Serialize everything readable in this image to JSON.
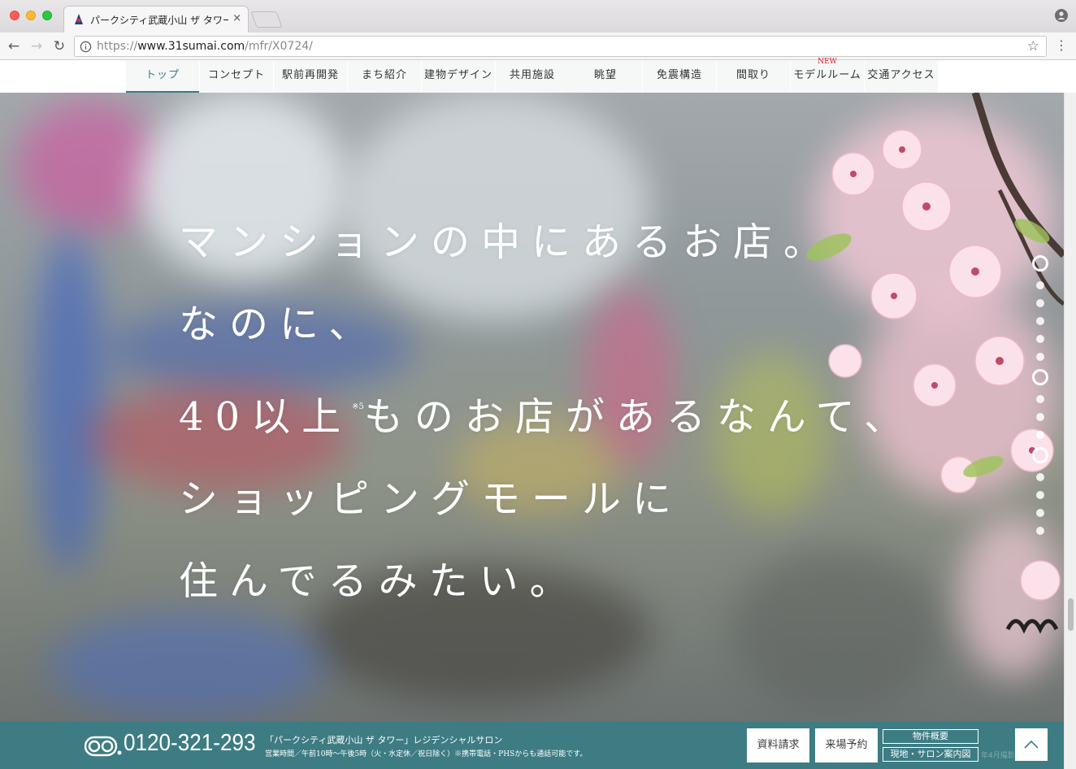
{
  "browser": {
    "tab_title": "パークシティ武蔵小山 ザ タワー",
    "tab_close": "×",
    "url_scheme": "https://",
    "url_host": "www.31sumai.com",
    "url_path": "/mfr/X0724/"
  },
  "nav": {
    "items": [
      "トップ",
      "コンセプト",
      "駅前再開発",
      "まち紹介",
      "建物デザイン",
      "共用施設",
      "眺望",
      "免震構造",
      "間取り",
      "モデルルーム",
      "交通アクセス"
    ],
    "new_badge": "NEW",
    "active_index": 0
  },
  "hero": {
    "lines": [
      "マンションの中にあるお店。",
      "なのに、",
      "40以上",
      "ものお店があるなんて、",
      "ショッピングモールに",
      "住んでるみたい。"
    ],
    "note": "※5",
    "dot_count": 15
  },
  "footer": {
    "phone": "0120-321-293",
    "salon": "「パークシティ武蔵小山 ザ タワー」レジデンシャルサロン",
    "hours": "営業時間／午前10時〜午後5時（火・水定休／祝日除く）※携帯電話・PHSからも通話可能です。",
    "request_label": "資料請求",
    "visit_label": "来場予約",
    "overview_label": "物件概要",
    "map_label": "現地・サロン案内図",
    "photo_note": "年4月撮影"
  },
  "colors": {
    "accent": "#3d7c83",
    "new_badge": "#d61c1c"
  }
}
